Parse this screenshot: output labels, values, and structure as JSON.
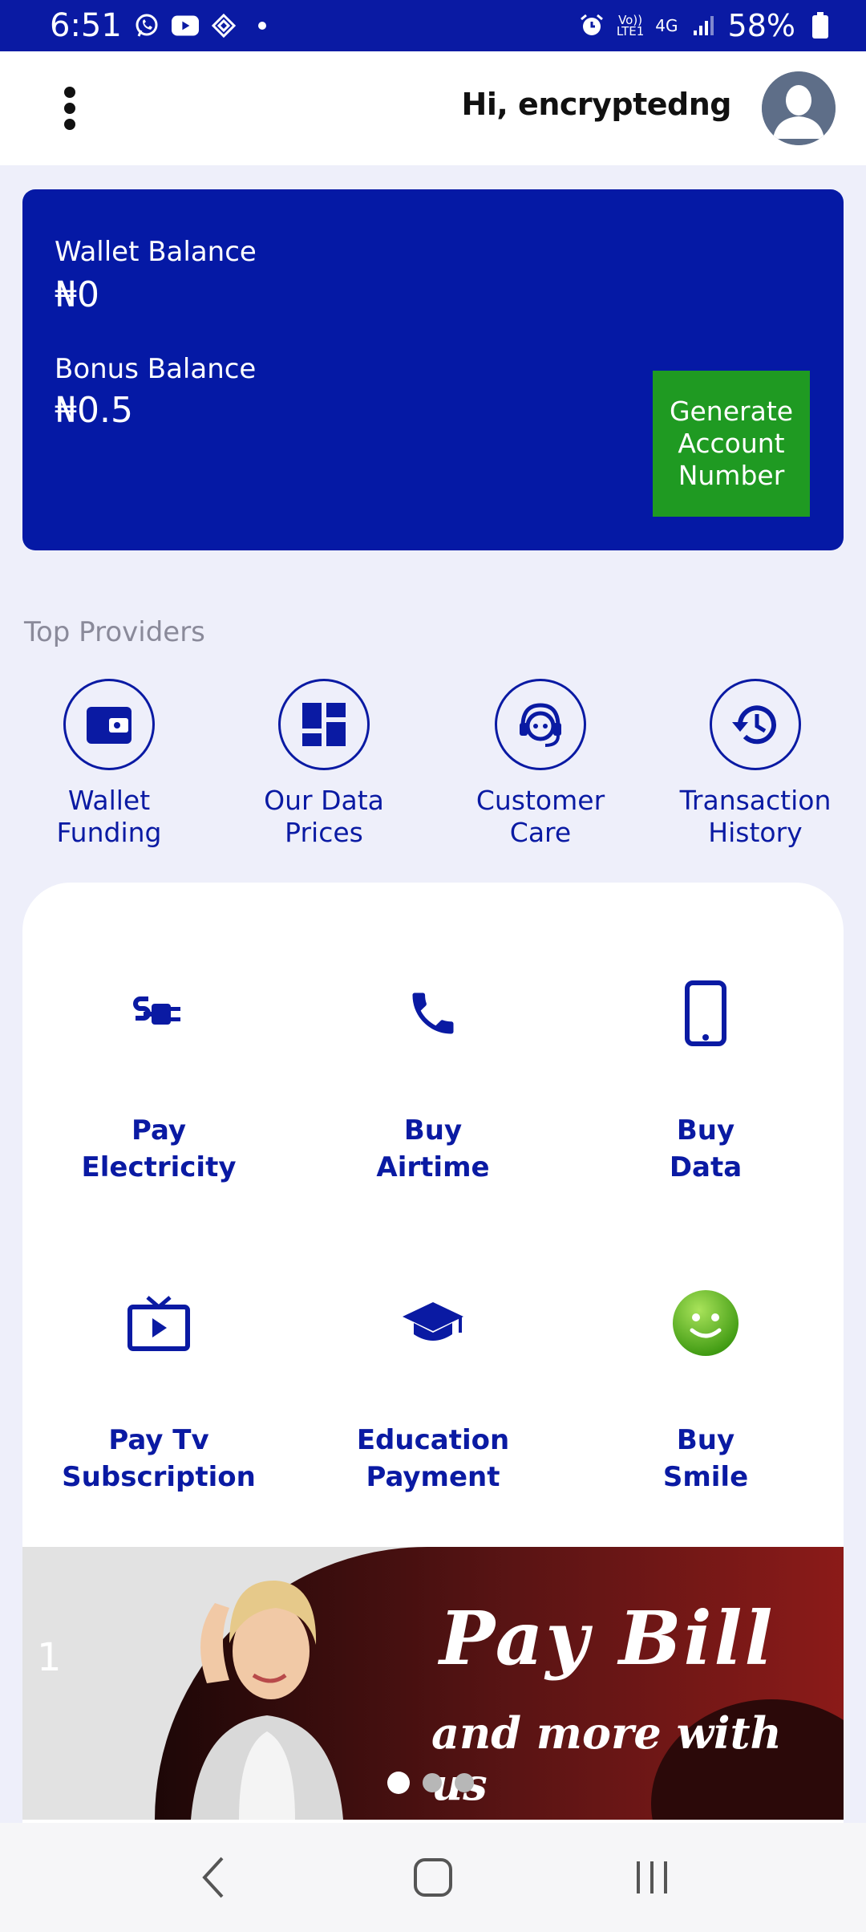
{
  "status_bar": {
    "time": "6:51",
    "network_top": "Vo))",
    "network_bottom": "LTE1",
    "network_type": "4G",
    "battery": "58%",
    "icons": [
      "whatsapp-icon",
      "youtube-icon",
      "app-icon",
      "dot-icon",
      "alarm-icon",
      "signal-icon",
      "battery-icon"
    ]
  },
  "header": {
    "greeting": "Hi, encryptedng",
    "menu_icon": "more-vert-icon",
    "avatar_icon": "user-avatar-icon"
  },
  "wallet": {
    "wallet_label": "Wallet Balance",
    "wallet_value": "₦0",
    "bonus_label": "Bonus Balance",
    "bonus_value": "₦0.5",
    "generate_button": "Generate Account Number"
  },
  "providers": {
    "title": "Top Providers",
    "items": [
      {
        "label": "Wallet\nFunding",
        "icon": "wallet-icon"
      },
      {
        "label": "Our Data\nPrices",
        "icon": "dashboard-icon"
      },
      {
        "label": "Customer\nCare",
        "icon": "support-agent-icon"
      },
      {
        "label": "Transaction\nHistory",
        "icon": "history-icon"
      }
    ]
  },
  "services": [
    {
      "label": "Pay\nElectricity",
      "icon": "power-plug-icon"
    },
    {
      "label": "Buy\nAirtime",
      "icon": "phone-icon"
    },
    {
      "label": "Buy\nData",
      "icon": "smartphone-icon"
    },
    {
      "label": "Pay Tv\nSubscription",
      "icon": "tv-icon"
    },
    {
      "label": "Education\nPayment",
      "icon": "school-icon"
    },
    {
      "label": "Buy\nSmile",
      "icon": "smile-icon"
    }
  ],
  "banner": {
    "slide_number": "1",
    "title": "Pay Bill",
    "subtitle": "and more with us",
    "slides_total": 3,
    "active_slide": 1
  },
  "colors": {
    "primary": "#0a1aa3",
    "card": "#0519a5",
    "button_green": "#1f9a22",
    "background": "#eeeffa"
  }
}
